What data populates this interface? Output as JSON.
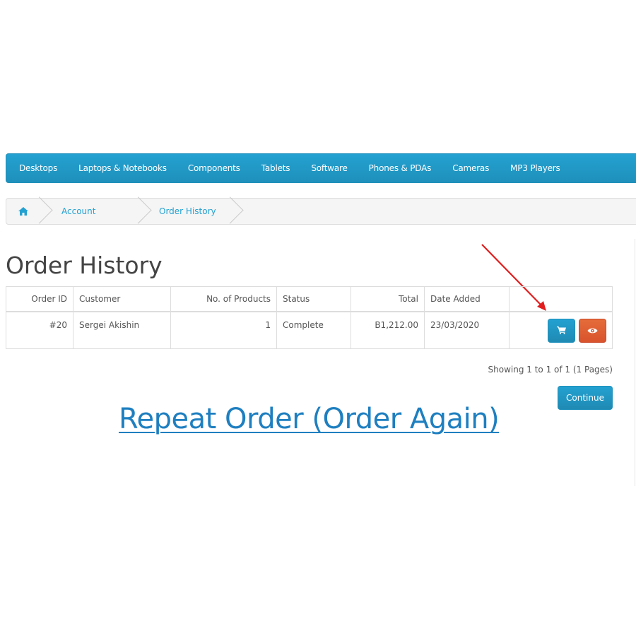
{
  "menu": {
    "items": [
      {
        "label": "Desktops"
      },
      {
        "label": "Laptops & Notebooks"
      },
      {
        "label": "Components"
      },
      {
        "label": "Tablets"
      },
      {
        "label": "Software"
      },
      {
        "label": "Phones & PDAs"
      },
      {
        "label": "Cameras"
      },
      {
        "label": "MP3 Players"
      }
    ]
  },
  "breadcrumb": {
    "home_icon": "home-icon",
    "items": [
      {
        "label": "Account"
      },
      {
        "label": "Order History"
      }
    ]
  },
  "page": {
    "title": "Order History"
  },
  "orders_table": {
    "headers": {
      "order_id": "Order ID",
      "customer": "Customer",
      "products": "No. of Products",
      "status": "Status",
      "total": "Total",
      "date_added": "Date Added"
    },
    "rows": [
      {
        "order_id": "#20",
        "customer": "Sergei Akishin",
        "products": "1",
        "status": "Complete",
        "total": "B1,212.00",
        "date_added": "23/03/2020",
        "actions": {
          "reorder_icon": "shopping-cart-icon",
          "view_icon": "eye-icon"
        }
      }
    ]
  },
  "pagination": {
    "text": "Showing 1 to 1 of 1 (1 Pages)"
  },
  "buttons": {
    "continue": "Continue"
  },
  "promo": {
    "text": "Repeat Order (Order Again)"
  },
  "colors": {
    "primary": "#23a1d1",
    "danger": "#e0583a",
    "arrow": "#e01e1e",
    "promo": "#1e7fc0"
  }
}
